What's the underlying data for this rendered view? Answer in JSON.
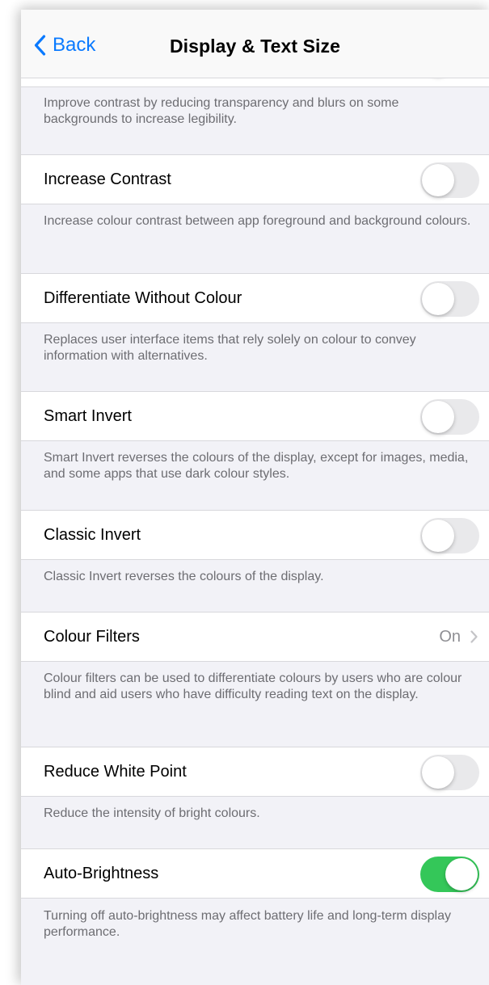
{
  "nav": {
    "back_label": "Back",
    "title": "Display & Text Size"
  },
  "reduce_transparency": {
    "footer": "Improve contrast by reducing transparency and blurs on some backgrounds to increase legibility."
  },
  "increase_contrast": {
    "label": "Increase Contrast",
    "toggle": "off",
    "footer": "Increase colour contrast between app foreground and background colours."
  },
  "differentiate_without_colour": {
    "label": "Differentiate Without Colour",
    "toggle": "off",
    "footer": "Replaces user interface items that rely solely on colour to convey information with alternatives."
  },
  "smart_invert": {
    "label": "Smart Invert",
    "toggle": "off",
    "footer": "Smart Invert reverses the colours of the display, except for images, media, and some apps that use dark colour styles."
  },
  "classic_invert": {
    "label": "Classic Invert",
    "toggle": "off",
    "footer": "Classic Invert reverses the colours of the display."
  },
  "colour_filters": {
    "label": "Colour Filters",
    "value": "On",
    "footer": "Colour filters can be used to differentiate colours by users who are colour blind and aid users who have difficulty reading text on the display."
  },
  "reduce_white_point": {
    "label": "Reduce White Point",
    "toggle": "off",
    "footer": "Reduce the intensity of bright colours."
  },
  "auto_brightness": {
    "label": "Auto-Brightness",
    "toggle": "on",
    "footer": "Turning off auto-brightness may affect battery life and long-term display performance."
  },
  "colors": {
    "accent": "#0a7aff",
    "toggle_on": "#34c759",
    "toggle_off": "#e9e9eb",
    "background": "#f2f2f7"
  }
}
